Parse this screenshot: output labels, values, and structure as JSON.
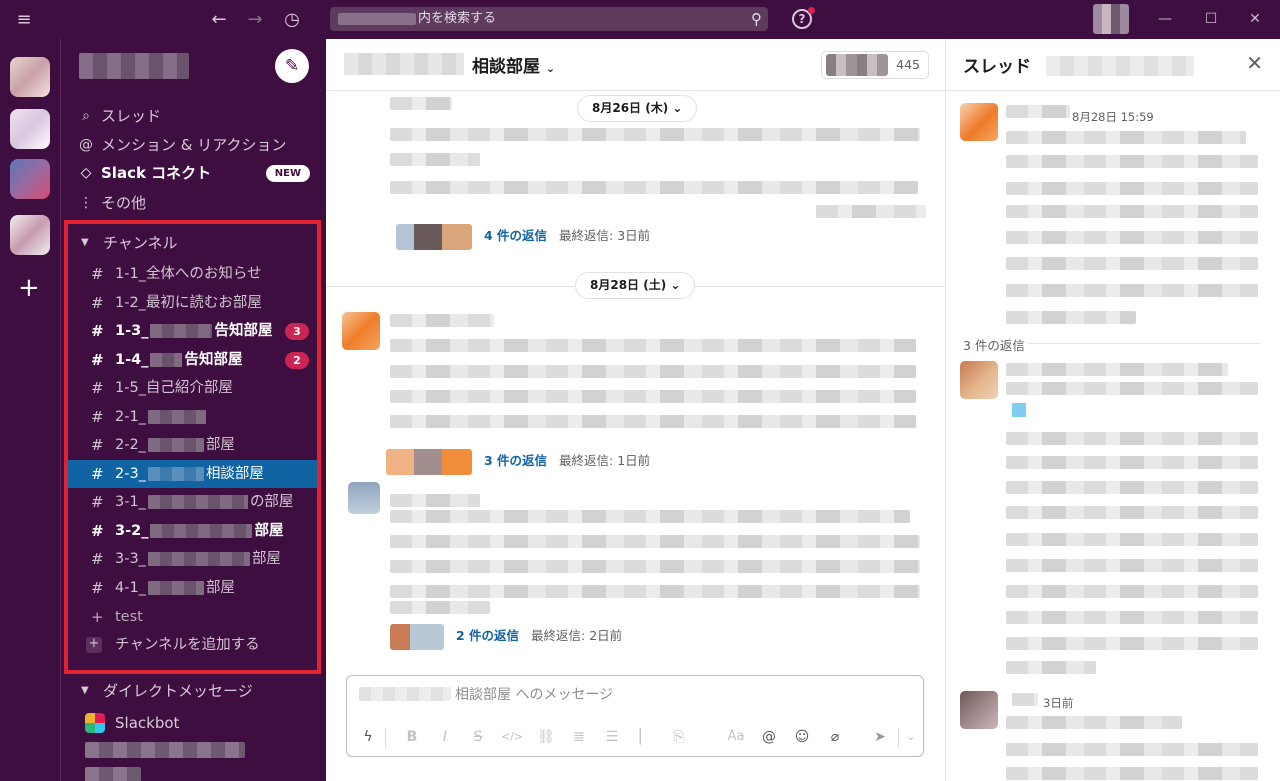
{
  "search": {
    "placeholder_suffix": "内を検索する"
  },
  "help": {
    "glyph": "?"
  },
  "sidebar": {
    "compose_icon": "✎",
    "nav": [
      {
        "icon": "thread-icon",
        "glyph": "⌕",
        "label": "スレッド"
      },
      {
        "icon": "at-icon",
        "glyph": "@",
        "label": "メンション & リアクション"
      },
      {
        "icon": "slack-connect-icon",
        "glyph": "◇",
        "label": "Slack コネクト",
        "badge": "NEW"
      },
      {
        "icon": "more-icon",
        "glyph": "⋮",
        "label": "その他"
      }
    ],
    "channels_header": "チャンネル",
    "channels": [
      {
        "prefix": "1-1_全体へのお知らせ",
        "blur": 0,
        "suffix": "",
        "unread": false,
        "active": false,
        "count": ""
      },
      {
        "prefix": "1-2_最初に読むお部屋",
        "blur": 0,
        "suffix": "",
        "unread": false,
        "active": false,
        "count": ""
      },
      {
        "prefix": "1-3_",
        "blur": 62,
        "suffix": "告知部屋",
        "unread": true,
        "active": false,
        "count": "3"
      },
      {
        "prefix": "1-4_",
        "blur": 32,
        "suffix": "告知部屋",
        "unread": true,
        "active": false,
        "count": "2"
      },
      {
        "prefix": "1-5_自己紹介部屋",
        "blur": 0,
        "suffix": "",
        "unread": false,
        "active": false,
        "count": ""
      },
      {
        "prefix": "2-1_",
        "blur": 58,
        "suffix": "",
        "unread": false,
        "active": false,
        "count": ""
      },
      {
        "prefix": "2-2_",
        "blur": 56,
        "suffix": "部屋",
        "unread": false,
        "active": false,
        "count": ""
      },
      {
        "prefix": "2-3_",
        "blur": 56,
        "suffix": "相談部屋",
        "unread": false,
        "active": true,
        "count": ""
      },
      {
        "prefix": "3-1_",
        "blur": 100,
        "suffix": "の部屋",
        "unread": false,
        "active": false,
        "count": ""
      },
      {
        "prefix": "3-2_",
        "blur": 102,
        "suffix": "部屋",
        "unread": true,
        "active": false,
        "count": ""
      },
      {
        "prefix": "3-3_",
        "blur": 102,
        "suffix": "部屋",
        "unread": false,
        "active": false,
        "count": ""
      },
      {
        "prefix": "4-1_",
        "blur": 56,
        "suffix": "部屋",
        "unread": false,
        "active": false,
        "count": ""
      }
    ],
    "test_channel": "test",
    "add_channel": "チャンネルを追加する",
    "dm_header": "ダイレクトメッセージ",
    "slackbot": "Slackbot"
  },
  "channel": {
    "title": "相談部屋",
    "member_count": "445",
    "date1": "8月26日 (木)",
    "date2": "8月28日 (土)",
    "thread1": {
      "link": "4 件の返信",
      "last": "最終返信: 3日前"
    },
    "thread2": {
      "link": "3 件の返信",
      "last": "最終返信: 1日前"
    },
    "thread3": {
      "link": "2 件の返信",
      "last": "最終返信: 2日前"
    },
    "composer_placeholder": "相談部屋 へのメッセージ"
  },
  "thread": {
    "title": "スレッド",
    "root_time": "8月28日 15:59",
    "reply_count": "3 件の返信",
    "last_time": "3日前"
  },
  "colors": {
    "aubergine": "#3f0e40",
    "active_channel": "#1164a3",
    "link": "#1264a3",
    "badge": "#cd2553",
    "highlight": "#e0232f"
  }
}
